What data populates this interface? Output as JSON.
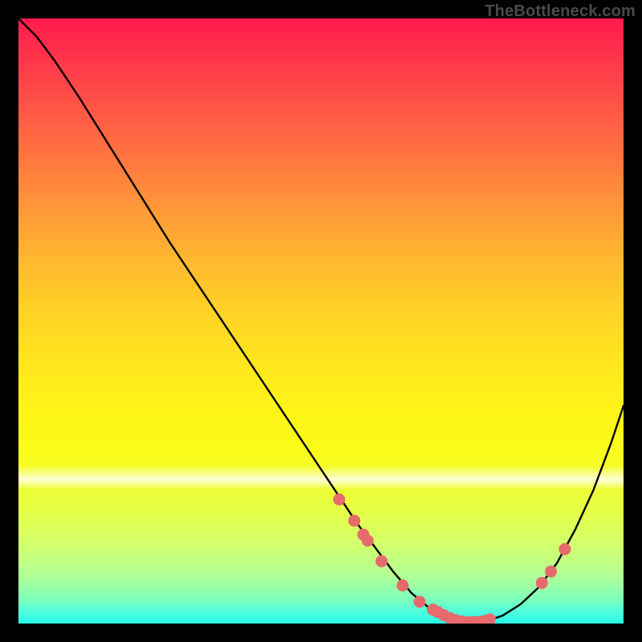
{
  "attribution": "TheBottleneck.com",
  "colors": {
    "curve_stroke": "#000000",
    "dot_fill": "#e76a6d",
    "background_frame": "#000000"
  },
  "chart_data": {
    "type": "line",
    "title": "",
    "xlabel": "",
    "ylabel": "",
    "xlim": [
      0,
      100
    ],
    "ylim": [
      0,
      100
    ],
    "series": [
      {
        "name": "bottleneck-curve",
        "x": [
          0,
          3,
          6,
          10,
          15,
          20,
          25,
          30,
          35,
          40,
          45,
          50,
          53,
          56,
          59,
          62,
          65,
          68,
          71,
          74,
          77,
          80,
          83,
          86,
          89,
          92,
          95,
          98,
          100
        ],
        "y": [
          100,
          97,
          93,
          87,
          79,
          71,
          63,
          55.5,
          48,
          40.5,
          33,
          25.5,
          21,
          16.5,
          12.5,
          8.5,
          5,
          2.5,
          1,
          0.3,
          0.3,
          1.3,
          3.2,
          6,
          10,
          15.5,
          22,
          30,
          36
        ]
      }
    ],
    "dots": {
      "name": "left-cluster-and-right-cluster",
      "points": [
        {
          "x": 53,
          "y": 20.5
        },
        {
          "x": 55.5,
          "y": 17
        },
        {
          "x": 57,
          "y": 14.7
        },
        {
          "x": 57.7,
          "y": 13.7
        },
        {
          "x": 60,
          "y": 10.3
        },
        {
          "x": 63.5,
          "y": 6.3
        },
        {
          "x": 66.3,
          "y": 3.6
        },
        {
          "x": 68.5,
          "y": 2.3
        },
        {
          "x": 69.3,
          "y": 1.9
        },
        {
          "x": 70.3,
          "y": 1.4
        },
        {
          "x": 71.3,
          "y": 0.9
        },
        {
          "x": 72.3,
          "y": 0.55
        },
        {
          "x": 73.3,
          "y": 0.35
        },
        {
          "x": 74.3,
          "y": 0.25
        },
        {
          "x": 75.3,
          "y": 0.25
        },
        {
          "x": 76.3,
          "y": 0.3
        },
        {
          "x": 77,
          "y": 0.4
        },
        {
          "x": 77.9,
          "y": 0.7
        },
        {
          "x": 86.5,
          "y": 6.7
        },
        {
          "x": 88,
          "y": 8.6
        },
        {
          "x": 90.3,
          "y": 12.3
        }
      ],
      "radius": 7.5
    }
  }
}
